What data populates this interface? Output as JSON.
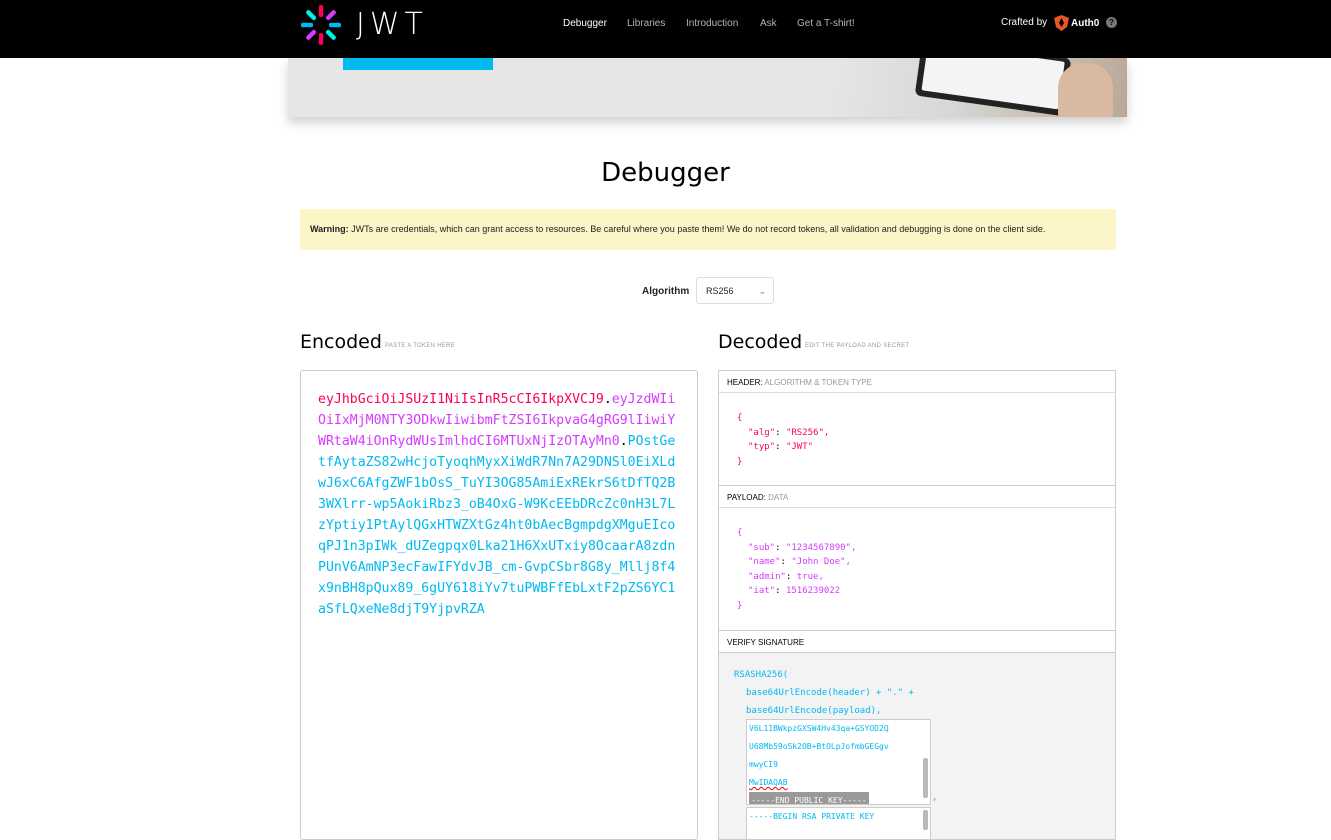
{
  "nav": {
    "logo_text": "JWT",
    "links": [
      "Debugger",
      "Libraries",
      "Introduction",
      "Ask",
      "Get a T-shirt!"
    ],
    "crafted_by": "Crafted by",
    "auth0": "Auth0",
    "help": "?"
  },
  "page": {
    "title": "Debugger",
    "warning_bold": "Warning:",
    "warning_text": " JWTs are credentials, which can grant access to resources. Be careful where you paste them! We do not record tokens, all validation and debugging is done on the client side."
  },
  "algorithm": {
    "label": "Algorithm",
    "selected": "RS256"
  },
  "encoded": {
    "title": "Encoded",
    "subtitle": "PASTE A TOKEN HERE",
    "header_part": "eyJhbGciOiJSUzI1NiIsInR5cCI6IkpXVCJ9",
    "payload_part": "eyJzdWIiOiIxMjM0NTY3ODkwIiwibmFtZSI6IkpvaG4gRG9lIiwiYWRtaW4iOnRydWUsImlhdCI6MTUxNjIzOTAyMn0",
    "signature_part": "POstGetfAytaZS82wHcjoTyoqhMyxXiWdR7Nn7A29DNSl0EiXLdwJ6xC6AfgZWF1bOsS_TuYI3OG85AmiExREkrS6tDfTQ2B3WXlrr-wp5AokiRbz3_oB4OxG-W9KcEEbDRcZc0nH3L7LzYptiy1PtAylQGxHTWZXtGz4ht0bAecBgmpdgXMguEIcoqPJ1n3pIWk_dUZegpqx0Lka21H6XxUTxiy8OcaarA8zdnPUnV6AmNP3ecFawIFYdvJB_cm-GvpCSbr8G8y_Mllj8f4x9nBH8pQux89_6gUY618iYv7tuPWBFfEbLxtF2pZS6YC1aSfLQxeNe8djT9YjpvRZA",
    "dot": "."
  },
  "decoded": {
    "title": "Decoded",
    "subtitle": "EDIT THE PAYLOAD AND SECRET",
    "header_label": "HEADER:",
    "header_sub": "ALGORITHM & TOKEN TYPE",
    "header_json": {
      "open": "{",
      "alg_key": "\"alg\"",
      "alg_val": "\"RS256\",",
      "typ_key": "\"typ\"",
      "typ_val": "\"JWT\"",
      "close": "}"
    },
    "payload_label": "PAYLOAD:",
    "payload_sub": "DATA",
    "payload_json": {
      "open": "{",
      "sub_key": "\"sub\"",
      "sub_val": "\"1234567890\",",
      "name_key": "\"name\"",
      "name_val": "\"John Doe\",",
      "admin_key": "\"admin\"",
      "admin_val": "true,",
      "iat_key": "\"iat\"",
      "iat_val": "1516239022",
      "close": "}"
    },
    "verify_label": "VERIFY SIGNATURE",
    "verify": {
      "fn": "RSASHA256(",
      "line1": "base64UrlEncode(header) + \".\" +",
      "line2": "base64UrlEncode(payload),",
      "public_key_lines": [
        "V6L11BWkpzGXSW4Hv43qa+GSYOD2Q",
        "U68Mb59oSk2OB+BtOLpJofmbGEGgv",
        "mwyCI9",
        "MwIDAQAB",
        "-----END PUBLIC KEY-----"
      ],
      "comma": ",",
      "private_key_first": "-----BEGIN RSA PRIVATE KEY"
    }
  },
  "colors": {
    "header": "#fb015b",
    "payload": "#d63aff",
    "signature": "#00b9f1"
  }
}
